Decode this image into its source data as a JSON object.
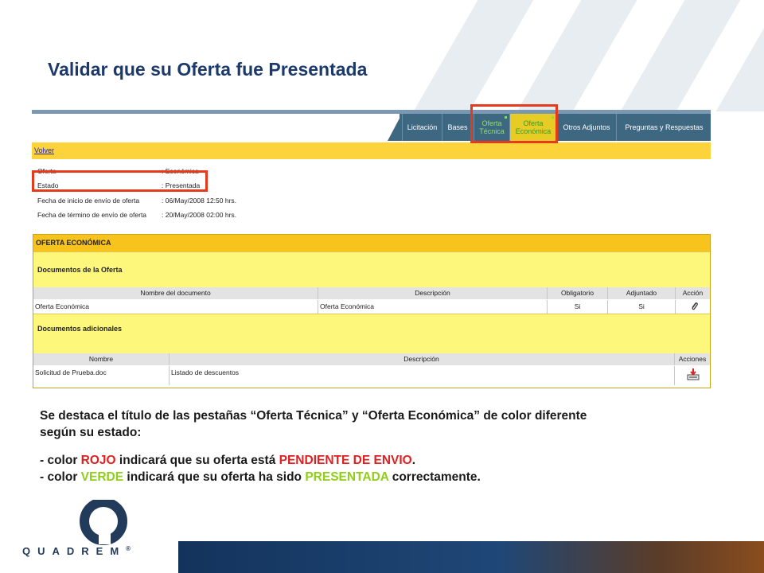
{
  "slide": {
    "title": "Validar que su Oferta fue Presentada"
  },
  "tabs": [
    {
      "label": "Licitación"
    },
    {
      "label": "Bases"
    },
    {
      "label_line1": "Oferta",
      "label_line2": "Técnica",
      "color": "#8fe36a"
    },
    {
      "label_line1": "Oferta",
      "label_line2": "Económica",
      "color": "#2f9c2a",
      "bg": "#e8cc26"
    },
    {
      "label": "Otros Adjuntos"
    },
    {
      "label": "Preguntas y Respuestas"
    }
  ],
  "nav": {
    "back_link": "Volver"
  },
  "info": [
    {
      "label": "Oferta",
      "value": ": Económica"
    },
    {
      "label": "Estado",
      "value": ": Presentada"
    },
    {
      "label": "Fecha de inicio de envío de oferta",
      "value": ": 06/May/2008 12:50 hrs."
    },
    {
      "label": "Fecha de término de envío de oferta",
      "value": ": 20/May/2008 02:00 hrs."
    }
  ],
  "oferta": {
    "header": "OFERTA ECONÓMICA",
    "docs_section": "Documentos de la Oferta",
    "docs_columns": [
      "Nombre del documento",
      "Descripción",
      "Obligatorio",
      "Adjuntado",
      "Acción"
    ],
    "docs_rows": [
      {
        "nombre": "Oferta Económica",
        "descripcion": "Oferta Económica",
        "obligatorio": "Si",
        "adjuntado": "Si",
        "accion_icon": "paperclip-icon"
      }
    ],
    "additional_section": "Documentos adicionales",
    "additional_columns": [
      "Nombre",
      "Descripción",
      "Acciones"
    ],
    "additional_rows": [
      {
        "nombre": "Solicitud de Prueba.doc",
        "descripcion": "Listado de descuentos",
        "accion_icon": "download-icon"
      }
    ]
  },
  "description": {
    "line1": "Se destaca el título de las pestañas “Oferta Técnica” y “Oferta Económica” de color diferente",
    "line2": "según su estado:",
    "red_prefix": "- color ",
    "red_word": "ROJO",
    "red_middle": " indicará que su oferta está ",
    "red_status": "PENDIENTE DE ENVIO",
    "red_suffix": ".",
    "green_prefix": "- color ",
    "green_word": "VERDE",
    "green_middle": " indicará que su oferta ha sido ",
    "green_status": "PRESENTADA",
    "green_suffix": " correctamente."
  },
  "brand": {
    "name": "QUADREM",
    "mark": "®"
  },
  "colors": {
    "highlight": "#e63a1c",
    "accent_red": "#e02020",
    "accent_green": "#8fcf1a",
    "title": "#1b3a6b"
  }
}
